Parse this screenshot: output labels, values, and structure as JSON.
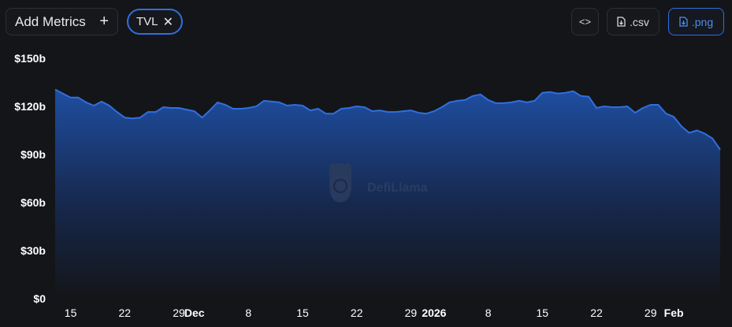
{
  "toolbar": {
    "add_metrics_label": "Add Metrics",
    "metric_chip_label": "TVL",
    "embed_label": "<>",
    "csv_label": ".csv",
    "png_label": ".png"
  },
  "watermark": {
    "text": "DefiLlama"
  },
  "colors": {
    "line": "#2f6fe0",
    "fill_top": "#1f4ea1",
    "background": "#141518",
    "accent": "#2f6fe0"
  },
  "chart_data": {
    "type": "area",
    "title": "",
    "xlabel": "",
    "ylabel": "",
    "ylim": [
      0,
      150
    ],
    "y_unit": "b",
    "grid": false,
    "y_ticks": [
      "$150b",
      "$120b",
      "$90b",
      "$60b",
      "$30b",
      "$0"
    ],
    "x_ticks": [
      {
        "label": "15",
        "major": false,
        "index": 2
      },
      {
        "label": "22",
        "major": false,
        "index": 9
      },
      {
        "label": "29",
        "major": false,
        "index": 16
      },
      {
        "label": "Dec",
        "major": true,
        "index": 18
      },
      {
        "label": "8",
        "major": false,
        "index": 25
      },
      {
        "label": "15",
        "major": false,
        "index": 32
      },
      {
        "label": "22",
        "major": false,
        "index": 39
      },
      {
        "label": "29",
        "major": false,
        "index": 46
      },
      {
        "label": "2026",
        "major": true,
        "index": 49
      },
      {
        "label": "8",
        "major": false,
        "index": 56
      },
      {
        "label": "15",
        "major": false,
        "index": 63
      },
      {
        "label": "22",
        "major": false,
        "index": 70
      },
      {
        "label": "29",
        "major": false,
        "index": 77
      },
      {
        "label": "Feb",
        "major": true,
        "index": 80
      }
    ],
    "series": [
      {
        "values": [
          130.5,
          128,
          125.5,
          125.5,
          122.5,
          120.5,
          123,
          120.5,
          116.5,
          113,
          112.5,
          113,
          116.5,
          116.5,
          119.5,
          119,
          119,
          118,
          117,
          113,
          117.5,
          122.5,
          121,
          118.5,
          118.5,
          119,
          120,
          123.5,
          123,
          122.5,
          120.5,
          121,
          120.5,
          117.5,
          118.5,
          115.5,
          115.5,
          118.5,
          119,
          120,
          119.5,
          117,
          117.5,
          116.5,
          116.5,
          117,
          117.5,
          116,
          115.5,
          117,
          119.5,
          122.5,
          123.5,
          124,
          126.5,
          127.5,
          124,
          122,
          122,
          122.5,
          123.5,
          122.5,
          123.5,
          128.5,
          129,
          128,
          128.5,
          129.5,
          126.5,
          126,
          119,
          120,
          119.5,
          119.5,
          120,
          116,
          119,
          121,
          121,
          115.5,
          113.5,
          107.5,
          103.5,
          105,
          103,
          100,
          93
        ]
      }
    ]
  }
}
